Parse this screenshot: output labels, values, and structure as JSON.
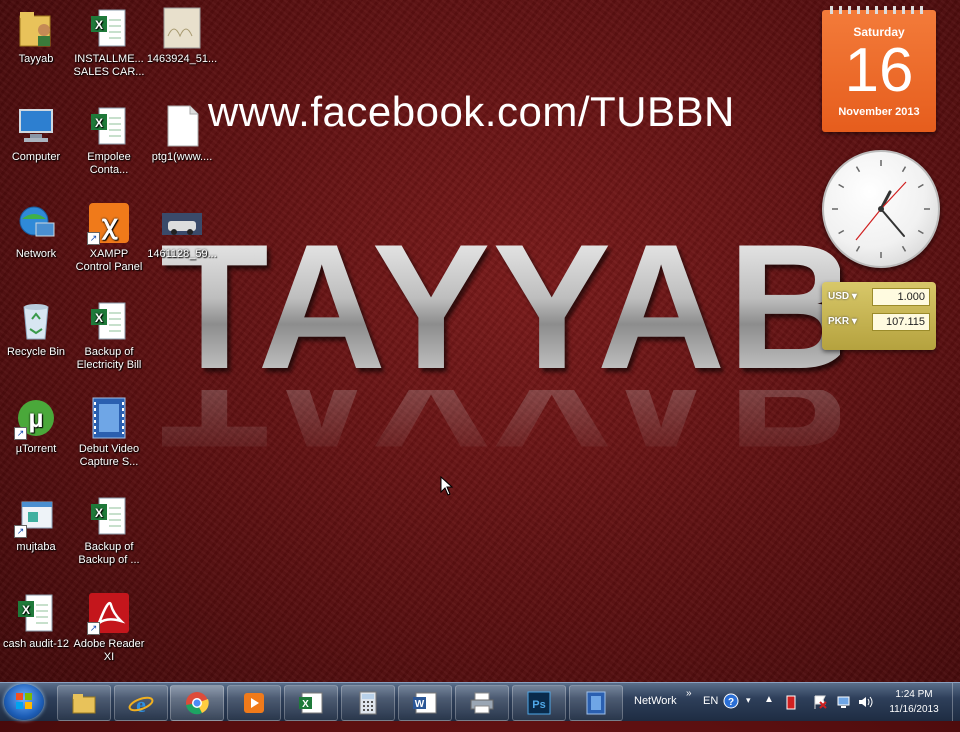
{
  "desktop": {
    "watermark_url": "www.facebook.com/TUBBN",
    "big_word": "TAYYAB",
    "icons": [
      {
        "label": "Tayyab"
      },
      {
        "label": "INSTALLME... SALES CAR..."
      },
      {
        "label": "1463924_51..."
      },
      {
        "label": "Computer"
      },
      {
        "label": "Empolee Conta..."
      },
      {
        "label": "ptg1(www...."
      },
      {
        "label": "Network"
      },
      {
        "label": "XAMPP Control Panel"
      },
      {
        "label": "1461128_59..."
      },
      {
        "label": "Recycle Bin"
      },
      {
        "label": "Backup of Electricity Bill"
      },
      {
        "label": "µTorrent"
      },
      {
        "label": "Debut Video Capture S..."
      },
      {
        "label": "mujtaba"
      },
      {
        "label": "Backup of Backup of ..."
      },
      {
        "label": "cash audit-12"
      },
      {
        "label": "Adobe Reader XI"
      }
    ]
  },
  "gadgets": {
    "calendar": {
      "day_name": "Saturday",
      "day_number": "16",
      "month_year": "November 2013"
    },
    "currency": {
      "from_code": "USD",
      "from_value": "1.000",
      "to_code": "PKR",
      "to_value": "107.115"
    }
  },
  "taskbar": {
    "network_label": "NetWork",
    "language": "EN",
    "time": "1:24 PM",
    "date": "11/16/2013",
    "pinned": [
      "Windows Explorer",
      "Internet Explorer",
      "Google Chrome",
      "Media Player",
      "Microsoft Excel",
      "Calculator",
      "Microsoft Word",
      "Printer",
      "Adobe Photoshop",
      "Video Capture"
    ]
  },
  "colors": {
    "desktop_bg": "#5a0f10",
    "calendar_bg": "#e65d1d",
    "currency_bg": "#c7b54f",
    "taskbar_bg": "#2e3f5a"
  }
}
